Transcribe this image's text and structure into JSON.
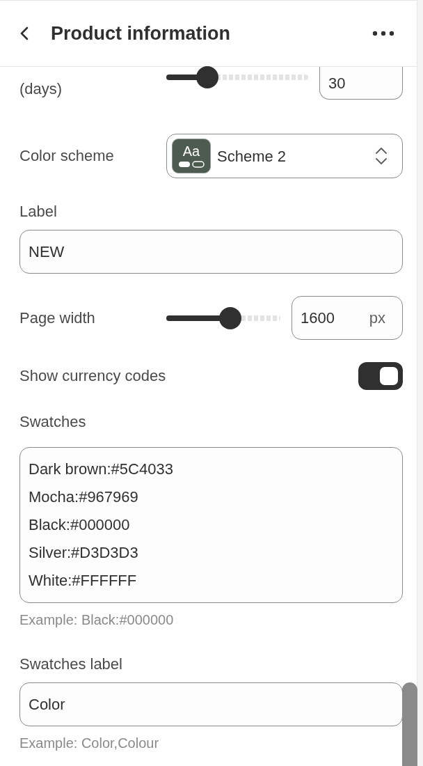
{
  "header": {
    "title": "Product information"
  },
  "fields": [
    {
      "kind": "slider",
      "label": "(days)",
      "level": 0.29,
      "value": "30"
    },
    {
      "kind": "select",
      "label": "Color scheme",
      "icon_text": "Aa",
      "value": "Scheme 2"
    },
    {
      "kind": "text",
      "label": "Label",
      "value": "NEW"
    },
    {
      "kind": "slider",
      "label": "Page width",
      "level": 0.56,
      "value": "1600",
      "unit": "px"
    },
    {
      "kind": "toggle",
      "label": "Show currency codes",
      "on": true
    },
    {
      "kind": "textarea",
      "label": "Swatches",
      "lines": [
        "Dark brown:#5C4033",
        "Mocha:#967969",
        "Black:#000000",
        "Silver:#D3D3D3",
        "White:#FFFFFF"
      ],
      "help": "Example: Black:#000000"
    },
    {
      "kind": "text",
      "label": "Swatches label",
      "value": "Color",
      "help": "Example: Color,Colour"
    }
  ]
}
